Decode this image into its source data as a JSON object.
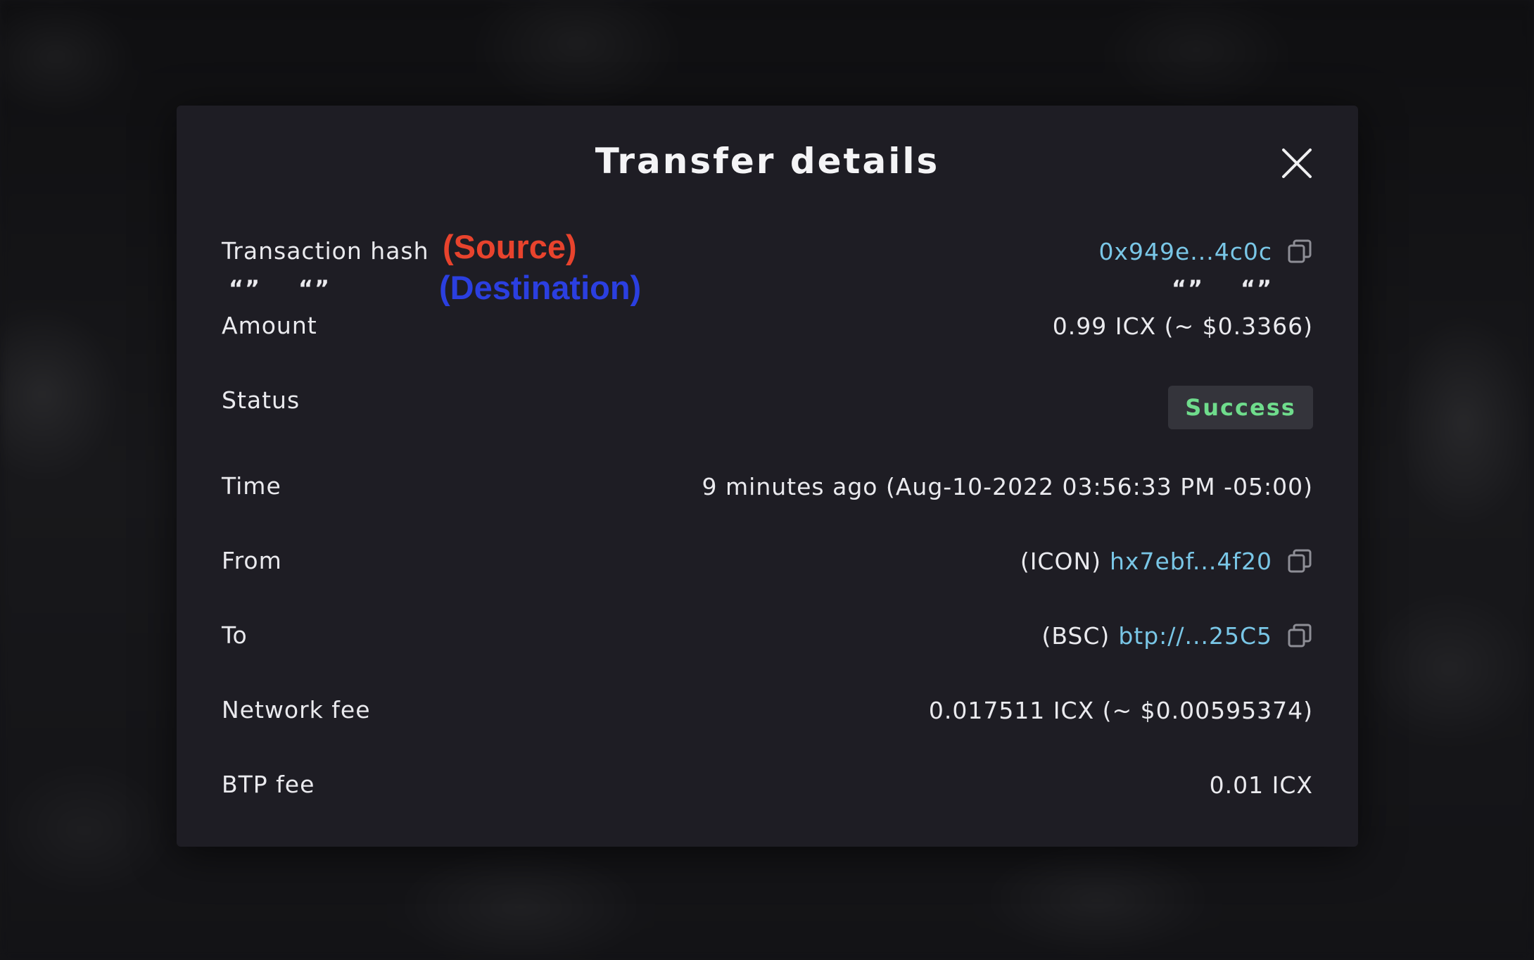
{
  "modal": {
    "title": "Transfer details"
  },
  "annotations": {
    "source": "(Source)",
    "destination": "(Destination)",
    "quote_mark": "“”"
  },
  "rows": {
    "transaction_hash": {
      "label": "Transaction hash",
      "value": "0x949e...4c0c",
      "icon": "copy-icon"
    },
    "amount": {
      "label": "Amount",
      "value": "0.99 ICX (~ $0.3366)"
    },
    "status": {
      "label": "Status",
      "value": "Success",
      "color": "#6fdc8c"
    },
    "time": {
      "label": "Time",
      "value": "9 minutes ago (Aug-10-2022 03:56:33 PM -05:00)"
    },
    "from": {
      "label": "From",
      "chain": "(ICON)",
      "value": "hx7ebf...4f20",
      "icon": "copy-icon"
    },
    "to": {
      "label": "To",
      "chain": "(BSC)",
      "value": "btp://...25C5",
      "icon": "copy-icon"
    },
    "network_fee": {
      "label": "Network fee",
      "value": "0.017511 ICX (~ $0.00595374)"
    },
    "btp_fee": {
      "label": "BTP fee",
      "value": "0.01 ICX"
    }
  },
  "colors": {
    "link": "#79c6e6",
    "annotation_source": "#e8432d",
    "annotation_destination": "#2b3fe0",
    "modal_background": "#1e1d24"
  }
}
